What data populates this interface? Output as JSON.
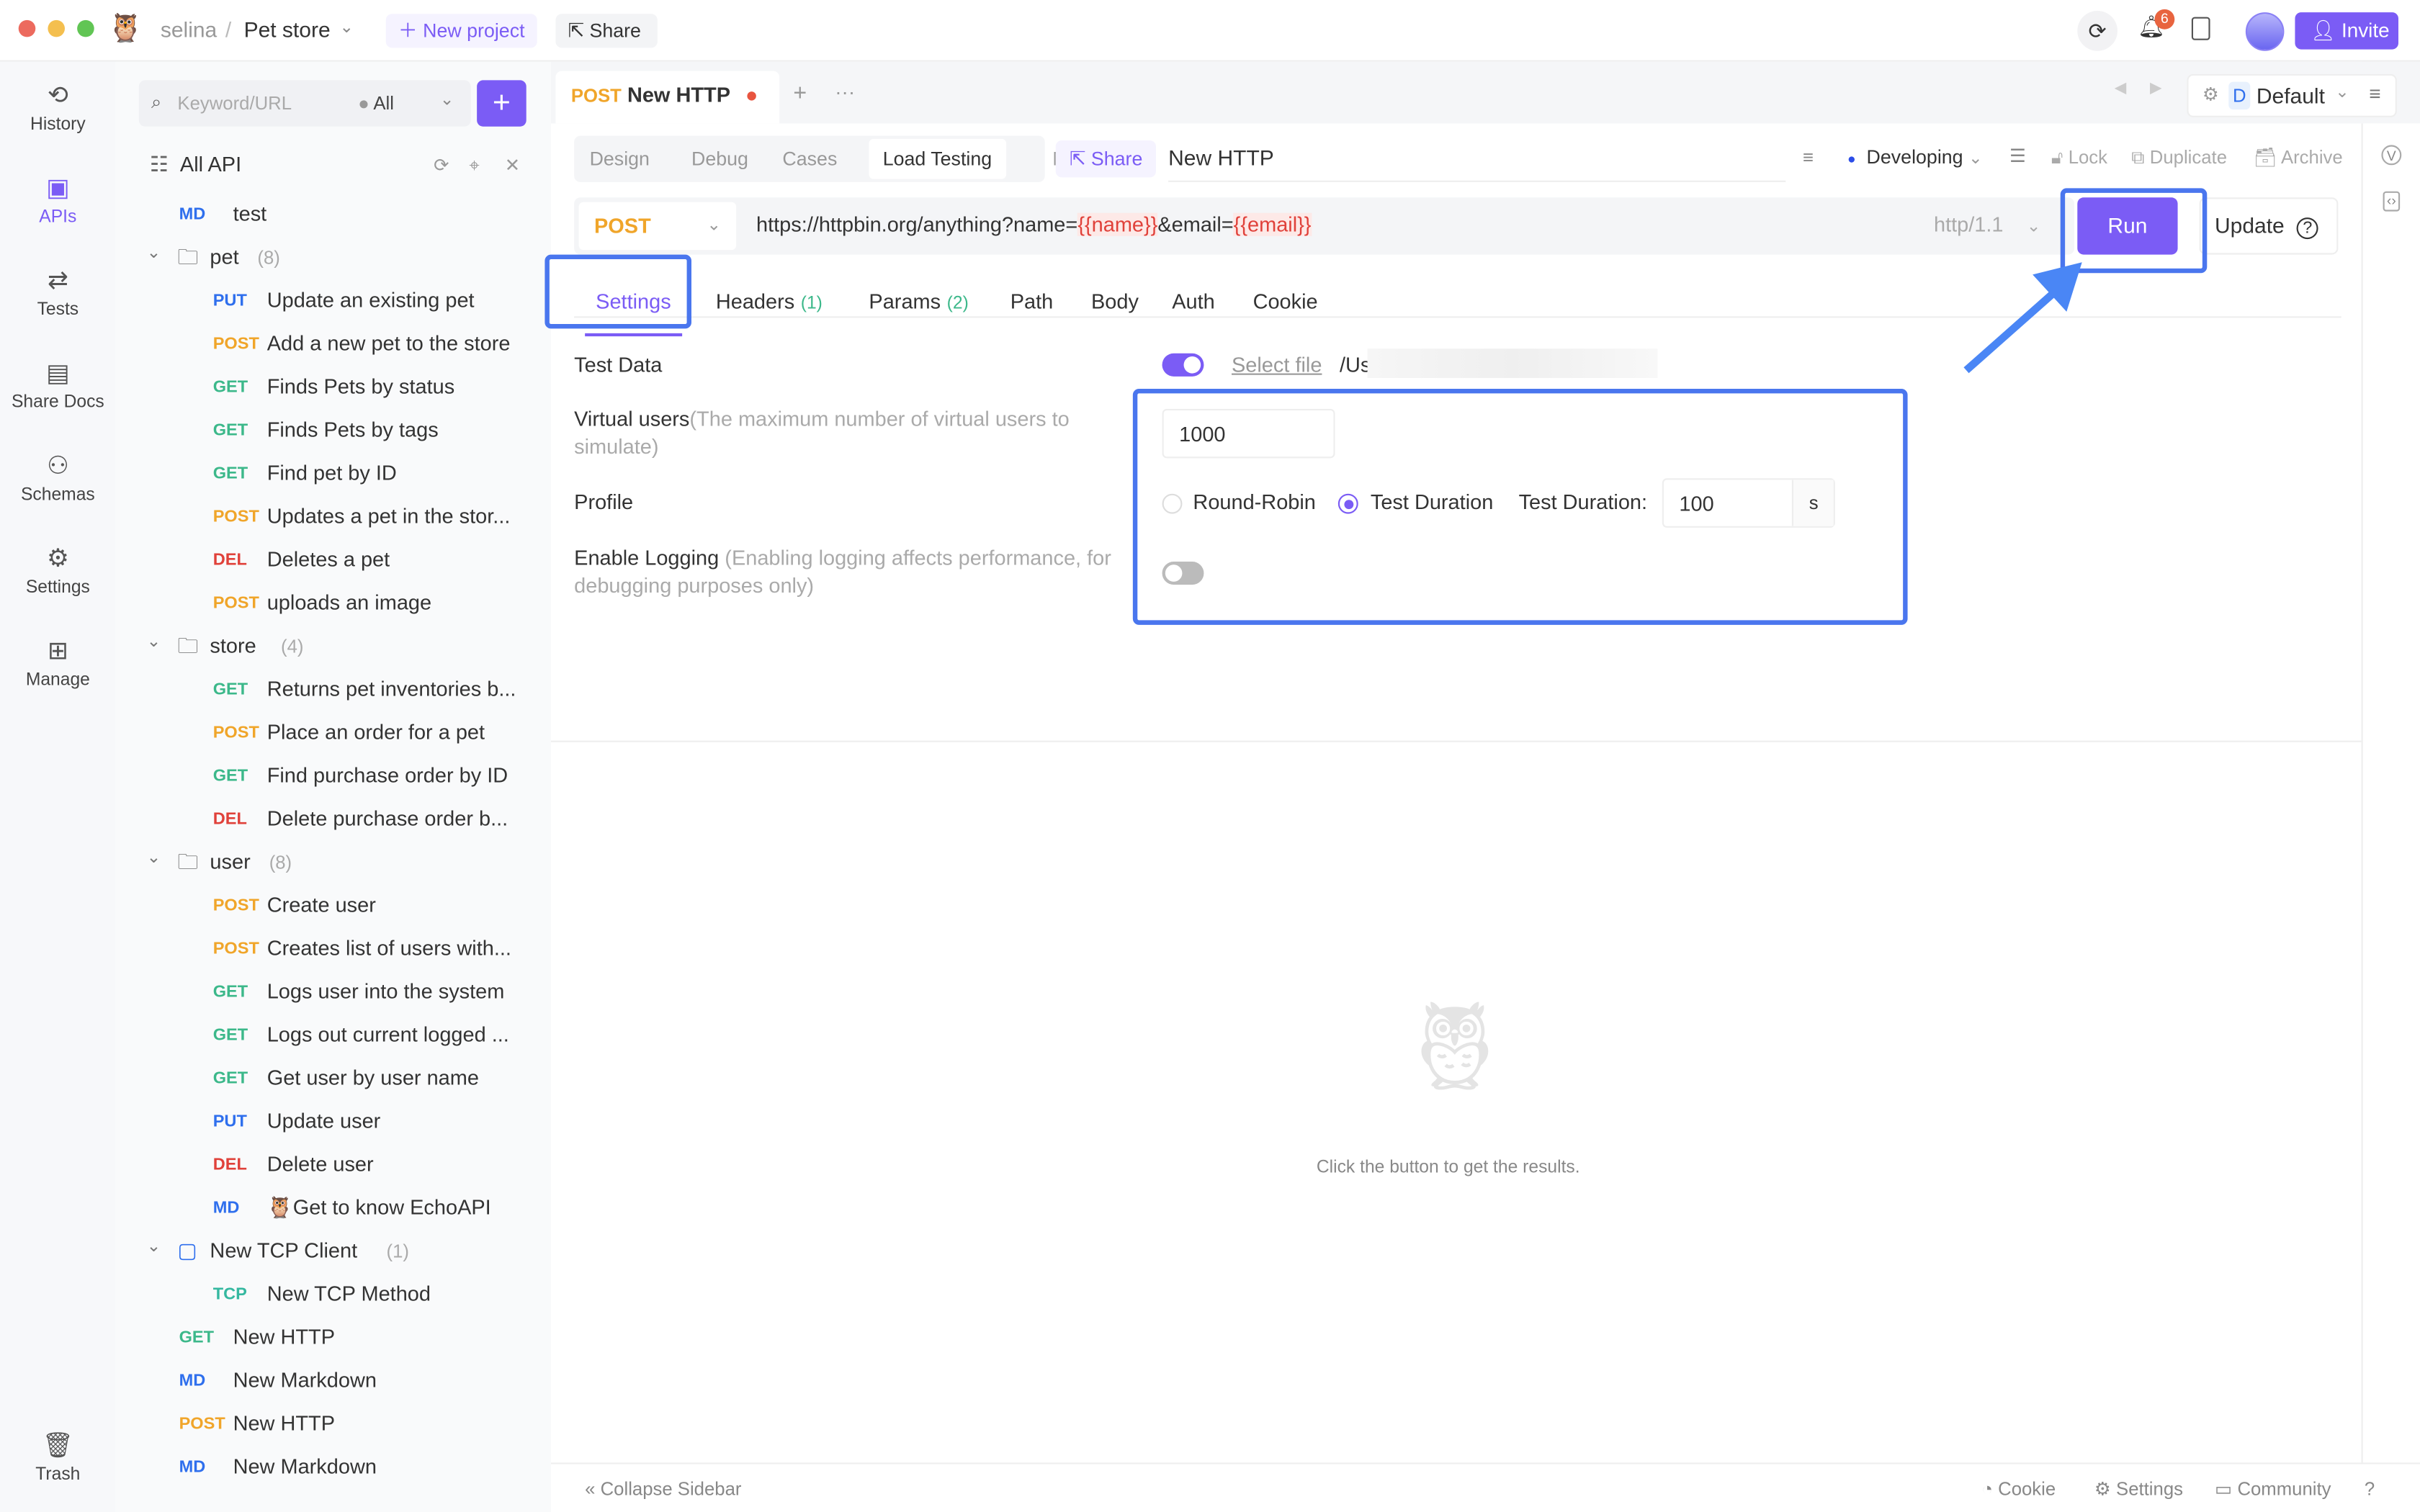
{
  "topbar": {
    "user": "selina",
    "project": "Pet store",
    "new_project": "New project",
    "share": "Share",
    "notif_count": "6",
    "invite": "Invite"
  },
  "rail": [
    {
      "label": "History",
      "icon": "history-icon"
    },
    {
      "label": "APIs",
      "icon": "apis-icon"
    },
    {
      "label": "Tests",
      "icon": "tests-icon"
    },
    {
      "label": "Share Docs",
      "icon": "share-docs-icon"
    },
    {
      "label": "Schemas",
      "icon": "schemas-icon"
    },
    {
      "label": "Settings",
      "icon": "settings-icon"
    },
    {
      "label": "Manage",
      "icon": "manage-icon"
    },
    {
      "label": "Trash",
      "icon": "trash-icon"
    }
  ],
  "sidebar": {
    "search_placeholder": "Keyword/URL",
    "filter": "All",
    "all_api": "All API",
    "items": [
      {
        "type": "item",
        "method": "MD",
        "label": "test",
        "level": 0
      },
      {
        "type": "folder",
        "label": "pet",
        "count": "(8)"
      },
      {
        "type": "item",
        "method": "PUT",
        "label": "Update an existing pet",
        "level": 1
      },
      {
        "type": "item",
        "method": "POST",
        "label": "Add a new pet to the store",
        "level": 1
      },
      {
        "type": "item",
        "method": "GET",
        "label": "Finds Pets by status",
        "level": 1
      },
      {
        "type": "item",
        "method": "GET",
        "label": "Finds Pets by tags",
        "level": 1
      },
      {
        "type": "item",
        "method": "GET",
        "label": "Find pet by ID",
        "level": 1
      },
      {
        "type": "item",
        "method": "POST",
        "label": "Updates a pet in the stor...",
        "level": 1
      },
      {
        "type": "item",
        "method": "DEL",
        "label": "Deletes a pet",
        "level": 1
      },
      {
        "type": "item",
        "method": "POST",
        "label": "uploads an image",
        "level": 1
      },
      {
        "type": "folder",
        "label": "store",
        "count": "(4)"
      },
      {
        "type": "item",
        "method": "GET",
        "label": "Returns pet inventories b...",
        "level": 1
      },
      {
        "type": "item",
        "method": "POST",
        "label": "Place an order for a pet",
        "level": 1
      },
      {
        "type": "item",
        "method": "GET",
        "label": "Find purchase order by ID",
        "level": 1
      },
      {
        "type": "item",
        "method": "DEL",
        "label": "Delete purchase order b...",
        "level": 1
      },
      {
        "type": "folder",
        "label": "user",
        "count": "(8)"
      },
      {
        "type": "item",
        "method": "POST",
        "label": "Create user",
        "level": 1
      },
      {
        "type": "item",
        "method": "POST",
        "label": "Creates list of users with...",
        "level": 1
      },
      {
        "type": "item",
        "method": "GET",
        "label": "Logs user into the system",
        "level": 1
      },
      {
        "type": "item",
        "method": "GET",
        "label": "Logs out current logged ...",
        "level": 1
      },
      {
        "type": "item",
        "method": "GET",
        "label": "Get user by user name",
        "level": 1
      },
      {
        "type": "item",
        "method": "PUT",
        "label": "Update user",
        "level": 1
      },
      {
        "type": "item",
        "method": "DEL",
        "label": "Delete user",
        "level": 1
      },
      {
        "type": "item",
        "method": "MD",
        "label": "🦉Get to know EchoAPI",
        "level": 1
      },
      {
        "type": "folder",
        "label": "New TCP Client",
        "count": "(1)",
        "tcp": true
      },
      {
        "type": "item",
        "method": "TCP",
        "label": "New TCP Method",
        "level": 1
      },
      {
        "type": "item",
        "method": "GET",
        "label": "New HTTP",
        "level": 0
      },
      {
        "type": "item",
        "method": "MD",
        "label": "New Markdown",
        "level": 0
      },
      {
        "type": "item",
        "method": "POST",
        "label": "New HTTP",
        "level": 0
      },
      {
        "type": "item",
        "method": "MD",
        "label": "New Markdown",
        "level": 0
      }
    ]
  },
  "method_colors": {
    "GET": "#3cb88a",
    "POST": "#f0a52a",
    "PUT": "#2f6fed",
    "DEL": "#e0413a",
    "MD": "#2f6fed",
    "TCP": "#35b8a0"
  },
  "tab": {
    "method": "POST",
    "name": "New HTTP"
  },
  "env": {
    "badge": "D",
    "name": "Default"
  },
  "subtabs": [
    "Design",
    "Debug",
    "Cases",
    "Load Testing",
    "Mock"
  ],
  "active_subtab": "Load Testing",
  "share": "Share",
  "api_name": "New HTTP",
  "status": "Developing",
  "actions": {
    "lock": "Lock",
    "duplicate": "Duplicate",
    "archive": "Archive"
  },
  "request": {
    "method": "POST",
    "url_prefix": "https://httpbin.org/anything?name=",
    "var1": "{{name}}",
    "url_mid": "&email=",
    "var2": "{{email}}",
    "protocol": "http/1.1",
    "run": "Run",
    "update": "Update"
  },
  "settings_tabs": [
    {
      "label": "Settings"
    },
    {
      "label": "Headers",
      "count": "(1)"
    },
    {
      "label": "Params",
      "count": "(2)"
    },
    {
      "label": "Path"
    },
    {
      "label": "Body"
    },
    {
      "label": "Auth"
    },
    {
      "label": "Cookie"
    }
  ],
  "form": {
    "test_data": "Test Data",
    "select_file": "Select file",
    "file_path": "/Us",
    "test_data_on": true,
    "virtual_users": "Virtual users",
    "virtual_users_hint": "(The maximum number of virtual users to simulate)",
    "virtual_users_value": "1000",
    "profile": "Profile",
    "round_robin": "Round-Robin",
    "test_duration": "Test Duration",
    "duration_label": "Test Duration:",
    "duration_value": "100",
    "duration_unit": "s",
    "logging": "Enable Logging",
    "logging_hint": "(Enabling logging affects performance, for debugging purposes only)",
    "logging_on": false
  },
  "empty_text": "Click the button to get the results.",
  "footer": {
    "collapse": "Collapse Sidebar",
    "cookie": "Cookie",
    "settings": "Settings",
    "community": "Community"
  }
}
